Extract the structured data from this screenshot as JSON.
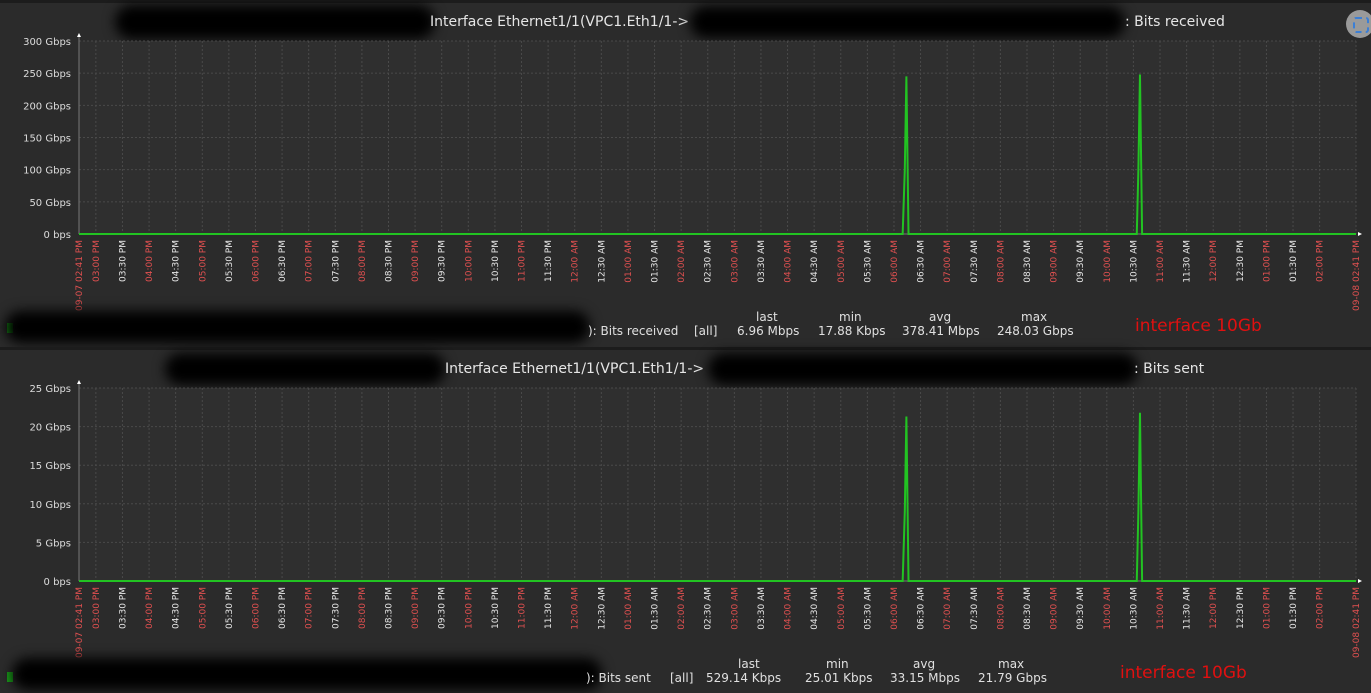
{
  "colors": {
    "series": "#22c322",
    "hour_tick": "#e05050",
    "half_tick": "#e6e6e6",
    "note": "#e01010"
  },
  "x_ticks": [
    "03:00 PM",
    "03:30 PM",
    "04:00 PM",
    "04:30 PM",
    "05:00 PM",
    "05:30 PM",
    "06:00 PM",
    "06:30 PM",
    "07:00 PM",
    "07:30 PM",
    "08:00 PM",
    "08:30 PM",
    "09:00 PM",
    "09:30 PM",
    "10:00 PM",
    "10:30 PM",
    "11:00 PM",
    "11:30 PM",
    "12:00 AM",
    "12:30 AM",
    "01:00 AM",
    "01:30 AM",
    "02:00 AM",
    "02:30 AM",
    "03:00 AM",
    "03:30 AM",
    "04:00 AM",
    "04:30 AM",
    "05:00 AM",
    "05:30 AM",
    "06:00 AM",
    "06:30 AM",
    "07:00 AM",
    "07:30 AM",
    "08:00 AM",
    "08:30 AM",
    "09:00 AM",
    "09:30 AM",
    "10:00 AM",
    "10:30 AM",
    "11:00 AM",
    "11:30 AM",
    "12:00 PM",
    "12:30 PM",
    "01:00 PM",
    "01:30 PM",
    "02:00 PM"
  ],
  "x_start": "09-07 02:41 PM",
  "x_end": "09-08 02:41 PM",
  "chart_data": [
    {
      "type": "line",
      "title_prefix": "Interface Ethernet1/1(VPC1.Eth1/1->",
      "title_suffix": ": Bits received",
      "ylabel": "Bits received",
      "unit": "Gbps",
      "ylim": [
        0,
        300
      ],
      "yticks": [
        {
          "v": 0,
          "label": "0 bps"
        },
        {
          "v": 50,
          "label": "50 Gbps"
        },
        {
          "v": 100,
          "label": "100 Gbps"
        },
        {
          "v": 150,
          "label": "150 Gbps"
        },
        {
          "v": 200,
          "label": "200 Gbps"
        },
        {
          "v": 250,
          "label": "250 Gbps"
        },
        {
          "v": 300,
          "label": "300 Gbps"
        }
      ],
      "xlim_hours": [
        0,
        24
      ],
      "series": [
        {
          "name": "Bits received",
          "points": [
            [
              0,
              0
            ],
            [
              15.48,
              0
            ],
            [
              15.52,
              100
            ],
            [
              15.55,
              245
            ],
            [
              15.59,
              0
            ],
            [
              19.88,
              0
            ],
            [
              19.91,
              100
            ],
            [
              19.94,
              248
            ],
            [
              19.98,
              0
            ],
            [
              24,
              0
            ]
          ]
        }
      ],
      "legend": {
        "name": "): Bits received",
        "scope": "[all]",
        "headers": [
          "last",
          "min",
          "avg",
          "max"
        ],
        "values": [
          "6.96 Mbps",
          "17.88 Kbps",
          "378.41 Mbps",
          "248.03 Gbps"
        ]
      },
      "note": "interface 10Gb"
    },
    {
      "type": "line",
      "title_prefix": "Interface Ethernet1/1(VPC1.Eth1/1->",
      "title_suffix": ": Bits sent",
      "ylabel": "Bits sent",
      "unit": "Gbps",
      "ylim": [
        0,
        25
      ],
      "yticks": [
        {
          "v": 0,
          "label": "0 bps"
        },
        {
          "v": 5,
          "label": "5 Gbps"
        },
        {
          "v": 10,
          "label": "10 Gbps"
        },
        {
          "v": 15,
          "label": "15 Gbps"
        },
        {
          "v": 20,
          "label": "20 Gbps"
        },
        {
          "v": 25,
          "label": "25 Gbps"
        }
      ],
      "xlim_hours": [
        0,
        24
      ],
      "series": [
        {
          "name": "Bits sent",
          "points": [
            [
              0,
              0
            ],
            [
              15.48,
              0
            ],
            [
              15.52,
              9
            ],
            [
              15.55,
              21.3
            ],
            [
              15.59,
              0
            ],
            [
              19.88,
              0
            ],
            [
              19.91,
              9
            ],
            [
              19.94,
              21.79
            ],
            [
              19.98,
              0
            ],
            [
              24,
              0
            ]
          ]
        }
      ],
      "legend": {
        "name": "): Bits sent",
        "scope": "[all]",
        "headers": [
          "last",
          "min",
          "avg",
          "max"
        ],
        "values": [
          "529.14 Kbps",
          "25.01 Kbps",
          "33.15 Mbps",
          "21.79 Gbps"
        ]
      },
      "note": "interface  10Gb"
    }
  ]
}
